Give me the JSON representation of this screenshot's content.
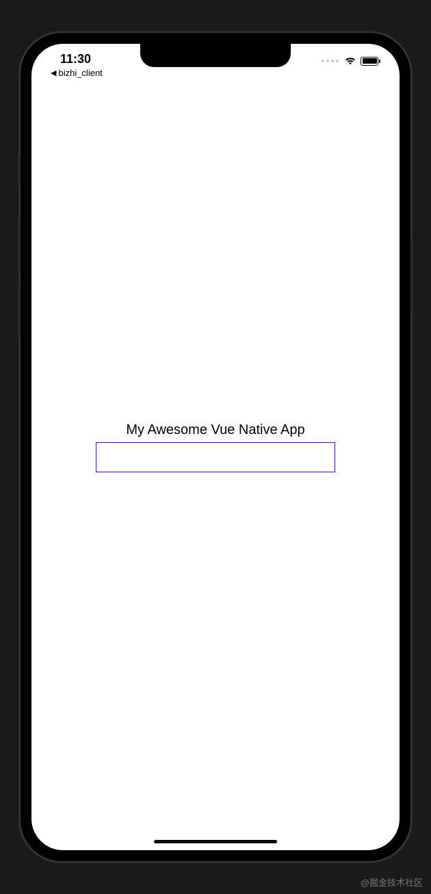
{
  "statusBar": {
    "time": "11:30",
    "backAppLabel": "bizhi_client"
  },
  "app": {
    "title": "My Awesome Vue Native App",
    "inputValue": ""
  },
  "watermark": "@掘金技术社区"
}
